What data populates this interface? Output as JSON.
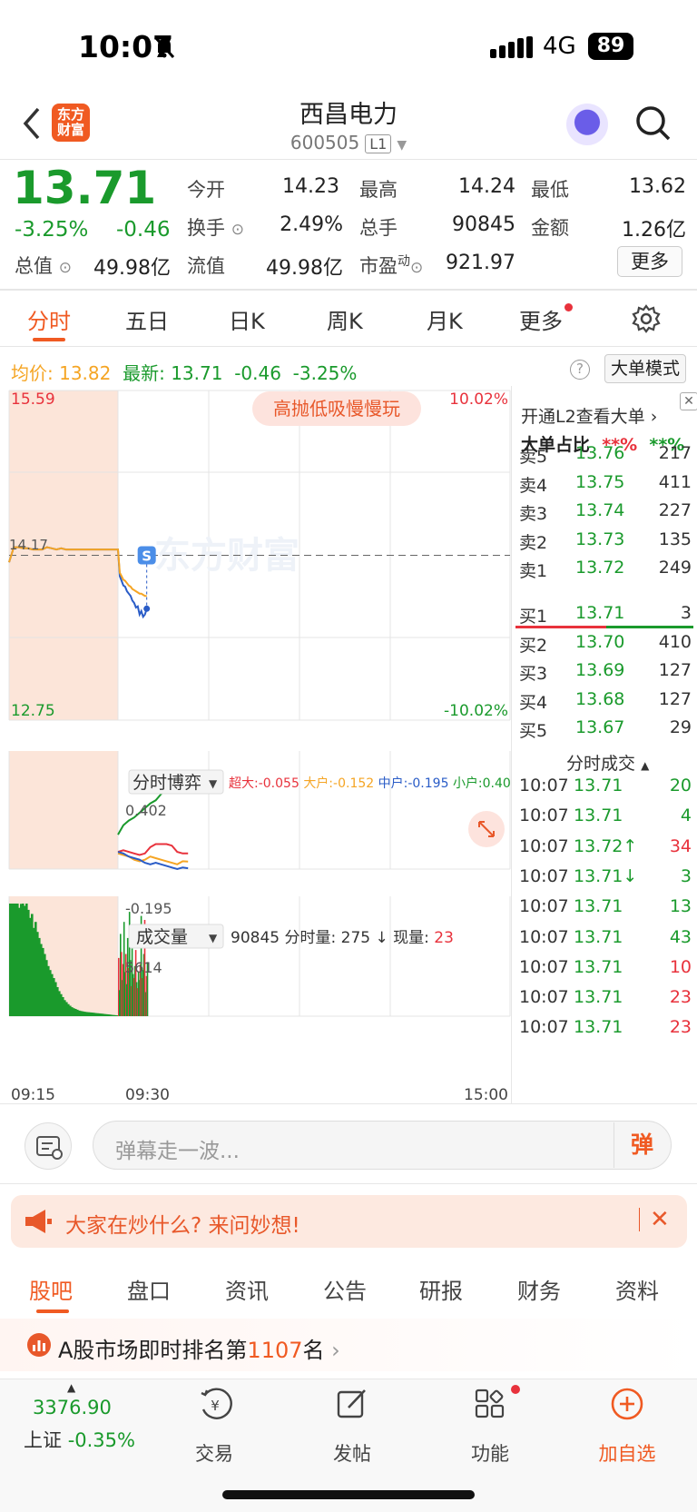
{
  "status_bar": {
    "time": "10:07",
    "network": "4G",
    "battery": "89"
  },
  "header": {
    "logo_text": "东方财富",
    "stock_name": "西昌电力",
    "stock_code": "600505",
    "level_badge": "L1"
  },
  "quote": {
    "price": "13.71",
    "change_pct": "-3.25%",
    "change": "-0.46",
    "fields": [
      {
        "label": "今开",
        "value": "14.23",
        "color": "#e8323c"
      },
      {
        "label": "最高",
        "value": "14.24",
        "color": "#e8323c"
      },
      {
        "label": "最低",
        "value": "13.62",
        "color": "#1a9a2c"
      },
      {
        "label": "换手",
        "value": "2.49%"
      },
      {
        "label": "总手",
        "value": "90845"
      },
      {
        "label": "金额",
        "value": "1.26亿"
      },
      {
        "label": "总值",
        "value": "49.98亿"
      },
      {
        "label": "流值",
        "value": "49.98亿"
      },
      {
        "label": "市盈",
        "sup": "动",
        "value": "921.97"
      }
    ],
    "more_button": "更多"
  },
  "chart_tabs": {
    "items": [
      "分时",
      "五日",
      "日K",
      "周K",
      "月K",
      "更多"
    ],
    "active": 0
  },
  "info_line": {
    "avg_label": "均价:",
    "avg_value": "13.82",
    "latest_label": "最新:",
    "latest_value": "13.71",
    "latest_change": "-0.46",
    "latest_pct": "-3.25%",
    "big_order_mode": "大单模式"
  },
  "chart_data": [
    {
      "type": "line",
      "title": "分时",
      "y_max_label": "15.59",
      "y_min_label": "12.75",
      "pct_max_label": "10.02%",
      "pct_min_label": "-10.02%",
      "prev_close_label": "14.17",
      "ylim": [
        12.75,
        15.59
      ],
      "x_labels": [
        "09:15",
        "09:30",
        "15:00"
      ],
      "badge": "高抛低吸慢慢玩",
      "marker": "S",
      "watermark": "东方财富",
      "series": [
        {
          "name": "最新",
          "color": "#2a5cc7",
          "values": [
            14.11,
            14.24,
            14.24,
            14.23,
            14.23,
            14.22,
            14.22,
            14.22,
            14.24,
            14.23,
            14.22,
            14.23,
            14.22,
            14.22,
            14.22,
            14.22,
            14.22,
            14.22,
            14.22,
            14.22,
            14.22,
            14.22,
            14.22,
            14.22,
            13.99,
            13.95,
            13.91,
            13.9,
            13.86,
            13.84,
            13.82,
            13.78,
            13.76,
            13.72,
            13.73,
            13.66,
            13.69,
            13.64,
            13.66,
            13.71
          ]
        },
        {
          "name": "均价",
          "color": "#f5a524",
          "values": [
            14.11,
            14.24,
            14.24,
            14.23,
            14.23,
            14.22,
            14.22,
            14.22,
            14.24,
            14.23,
            14.22,
            14.23,
            14.22,
            14.22,
            14.22,
            14.22,
            14.22,
            14.22,
            14.22,
            14.22,
            14.22,
            14.22,
            14.22,
            14.22,
            14.02,
            13.99,
            13.96,
            13.95,
            13.93,
            13.91,
            13.9,
            13.88,
            13.87,
            13.86,
            13.85,
            13.84,
            13.84,
            13.83,
            13.82,
            13.82
          ]
        }
      ]
    },
    {
      "type": "line",
      "title": "分时博弈",
      "legend": [
        {
          "name": "超大",
          "value": "-0.055",
          "color": "#e8323c"
        },
        {
          "name": "大户",
          "value": "-0.152",
          "color": "#f5a524"
        },
        {
          "name": "中户",
          "value": "-0.195",
          "color": "#2a5cc7"
        },
        {
          "name": "小户",
          "value": "0.402",
          "color": "#1a9a2c"
        }
      ],
      "y_top_label": "0.402",
      "y_bottom_label": "-0.195",
      "ylim": [
        -0.2,
        0.41
      ],
      "series": [
        {
          "name": "小户",
          "color": "#1a9a2c",
          "values": [
            0.02,
            0.08,
            0.11,
            0.13,
            0.16,
            0.19,
            0.22,
            0.24,
            0.28,
            0.31,
            0.34,
            0.37,
            0.4,
            0.402
          ]
        },
        {
          "name": "超大",
          "color": "#e8323c",
          "values": [
            -0.09,
            -0.08,
            -0.09,
            -0.1,
            -0.11,
            -0.1,
            -0.06,
            -0.04,
            -0.04,
            -0.04,
            -0.05,
            -0.09,
            -0.1,
            -0.1
          ]
        },
        {
          "name": "大户",
          "color": "#f5a524",
          "values": [
            -0.1,
            -0.11,
            -0.12,
            -0.14,
            -0.15,
            -0.14,
            -0.12,
            -0.13,
            -0.14,
            -0.15,
            -0.16,
            -0.17,
            -0.15,
            -0.152
          ]
        },
        {
          "name": "中户",
          "color": "#2a5cc7",
          "values": [
            -0.09,
            -0.1,
            -0.12,
            -0.13,
            -0.14,
            -0.16,
            -0.17,
            -0.16,
            -0.17,
            -0.18,
            -0.19,
            -0.2,
            -0.19,
            -0.195
          ]
        }
      ]
    },
    {
      "type": "bar",
      "title": "成交量",
      "total": "90845",
      "minute_label": "分时量:",
      "minute_value": "275",
      "now_label": "现量:",
      "now_value": "23",
      "y_top_label": "5614",
      "ylim": [
        0,
        5614
      ],
      "values": [
        5614,
        5614,
        5614,
        5614,
        5614,
        5400,
        5600,
        5614,
        5500,
        5614,
        5300,
        4900,
        5100,
        4400,
        4700,
        4200,
        3900,
        3600,
        3400,
        3100,
        2800,
        2500,
        2300,
        2100,
        1900,
        1700,
        1450,
        1250,
        1100,
        950,
        800,
        700,
        600,
        520,
        450,
        400,
        360,
        320,
        280,
        260,
        240,
        220,
        210,
        200,
        190,
        180,
        170,
        160,
        150,
        140,
        130,
        120,
        110,
        100,
        90,
        80,
        70,
        60,
        50,
        40,
        2900,
        1300,
        4100,
        3200,
        1800,
        2600,
        4700,
        2200,
        3100,
        1600,
        3900,
        2400,
        5200,
        2800,
        1500,
        3600,
        2100,
        1900,
        2500,
        3300,
        1700,
        1400,
        2200,
        1800,
        2600,
        5000,
        1900,
        2300,
        3100,
        4800,
        1200,
        2000,
        2700
      ],
      "colors": [
        "g",
        "g",
        "g",
        "g",
        "g",
        "g",
        "g",
        "g",
        "g",
        "g",
        "g",
        "g",
        "g",
        "g",
        "g",
        "g",
        "g",
        "g",
        "g",
        "g",
        "g",
        "g",
        "g",
        "g",
        "g",
        "g",
        "g",
        "g",
        "g",
        "g",
        "g",
        "g",
        "g",
        "g",
        "g",
        "g",
        "g",
        "g",
        "g",
        "g",
        "g",
        "g",
        "g",
        "g",
        "g",
        "g",
        "g",
        "g",
        "g",
        "g",
        "g",
        "g",
        "g",
        "g",
        "g",
        "g",
        "g",
        "g",
        "g",
        "g",
        "r",
        "g",
        "g",
        "r",
        "g",
        "r",
        "g",
        "g",
        "r",
        "g",
        "g",
        "r",
        "g",
        "g",
        "r",
        "g",
        "g",
        "r",
        "g",
        "r",
        "g",
        "r",
        "g",
        "g",
        "r",
        "g",
        "r",
        "g",
        "g",
        "r",
        "g",
        "r",
        "g"
      ]
    }
  ],
  "right_panel": {
    "l2_link": "开通L2查看大单",
    "big_ratio_label": "大单占比",
    "big_ratio_red": "**%",
    "big_ratio_green": "**%",
    "sells": [
      {
        "label": "卖5",
        "price": "13.76",
        "vol": "217"
      },
      {
        "label": "卖4",
        "price": "13.75",
        "vol": "411"
      },
      {
        "label": "卖3",
        "price": "13.74",
        "vol": "227"
      },
      {
        "label": "卖2",
        "price": "13.73",
        "vol": "135"
      },
      {
        "label": "卖1",
        "price": "13.72",
        "vol": "249"
      }
    ],
    "buys": [
      {
        "label": "买1",
        "price": "13.71",
        "vol": "3"
      },
      {
        "label": "买2",
        "price": "13.70",
        "vol": "410"
      },
      {
        "label": "买3",
        "price": "13.69",
        "vol": "127"
      },
      {
        "label": "买4",
        "price": "13.68",
        "vol": "127"
      },
      {
        "label": "买5",
        "price": "13.67",
        "vol": "29"
      }
    ],
    "trades_title": "分时成交",
    "trades": [
      {
        "time": "10:07",
        "price": "13.71",
        "arrow": "",
        "vol": "20",
        "vol_color": "#1a9a2c"
      },
      {
        "time": "10:07",
        "price": "13.71",
        "arrow": "",
        "vol": "4",
        "vol_color": "#1a9a2c"
      },
      {
        "time": "10:07",
        "price": "13.72",
        "arrow": "↑",
        "vol": "34",
        "vol_color": "#e8323c"
      },
      {
        "time": "10:07",
        "price": "13.71",
        "arrow": "↓",
        "vol": "3",
        "vol_color": "#1a9a2c"
      },
      {
        "time": "10:07",
        "price": "13.71",
        "arrow": "",
        "vol": "13",
        "vol_color": "#1a9a2c"
      },
      {
        "time": "10:07",
        "price": "13.71",
        "arrow": "",
        "vol": "43",
        "vol_color": "#1a9a2c"
      },
      {
        "time": "10:07",
        "price": "13.71",
        "arrow": "",
        "vol": "10",
        "vol_color": "#e8323c"
      },
      {
        "time": "10:07",
        "price": "13.71",
        "arrow": "",
        "vol": "23",
        "vol_color": "#e8323c"
      },
      {
        "time": "10:07",
        "price": "13.71",
        "arrow": "",
        "vol": "23",
        "vol_color": "#e8323c"
      }
    ]
  },
  "danmu": {
    "placeholder": "弹幕走一波...",
    "button": "弹"
  },
  "banner": {
    "text": "大家在炒什么? 来问妙想!"
  },
  "bottom_tabs": {
    "items": [
      "股吧",
      "盘口",
      "资讯",
      "公告",
      "研报",
      "财务",
      "资料"
    ],
    "active": 0
  },
  "rank": {
    "prefix": "A股市场即时排名第",
    "number": "1107",
    "suffix": "名"
  },
  "navbar": {
    "index_value": "3376.90",
    "index_name": "上证",
    "index_change": "-0.35%",
    "items": [
      "交易",
      "发帖",
      "功能",
      "加自选"
    ]
  },
  "colors": {
    "up": "#e8323c",
    "down": "#1a9a2c",
    "accent": "#f05a22",
    "avg": "#f5a524",
    "line": "#2a5cc7"
  }
}
